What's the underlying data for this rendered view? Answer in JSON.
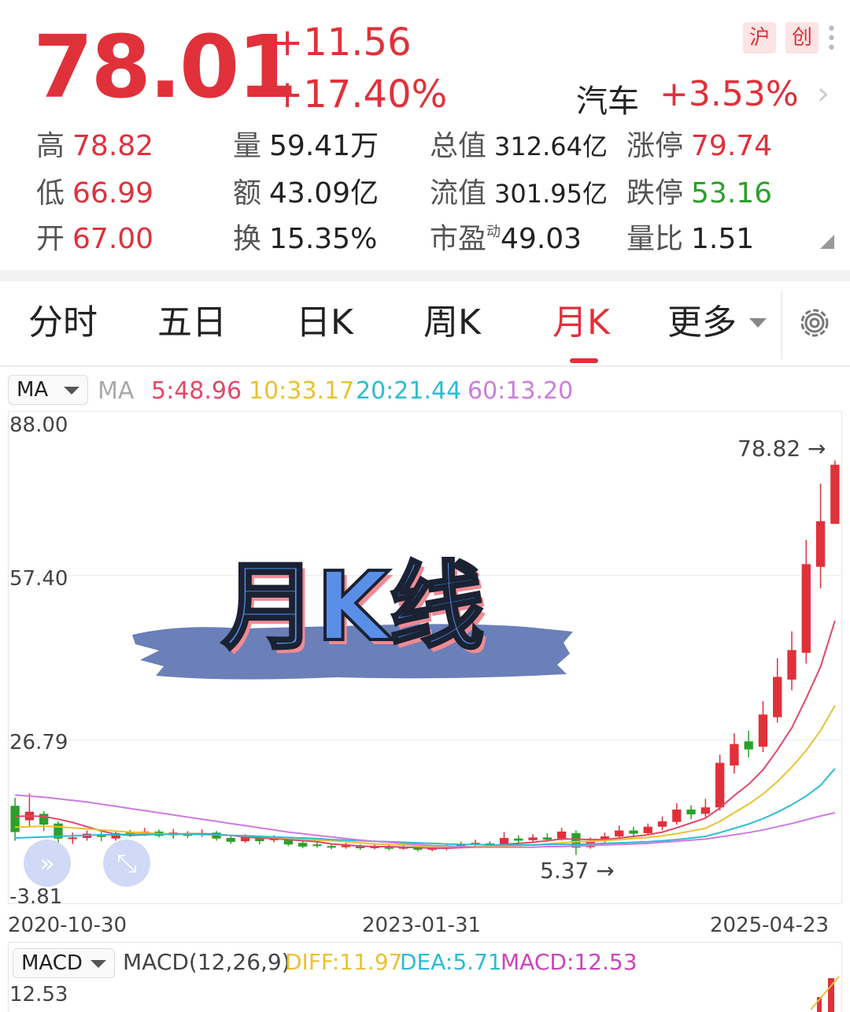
{
  "quote": {
    "price": "78.01",
    "change": "+11.56",
    "change_pct": "+17.40%",
    "badges": [
      "沪",
      "创"
    ],
    "sector": "汽车",
    "sector_pct": "+3.53%"
  },
  "stats": {
    "high_label": "高",
    "high": "78.82",
    "low_label": "低",
    "low": "66.99",
    "open_label": "开",
    "open": "67.00",
    "vol_label": "量",
    "vol": "59.41万",
    "amt_label": "额",
    "amt": "43.09亿",
    "turn_label": "换",
    "turn": "15.35%",
    "mcap_label": "总值",
    "mcap": "312.64亿",
    "fcap_label": "流值",
    "fcap": "301.95亿",
    "pe_label": "市盈",
    "pe_sup": "动",
    "pe": "49.03",
    "up_label": "涨停",
    "up": "79.74",
    "down_label": "跌停",
    "down": "53.16",
    "vr_label": "量比",
    "vr": "1.51"
  },
  "tabs": [
    "分时",
    "五日",
    "日K",
    "周K",
    "月K",
    "更多"
  ],
  "active_tab": "月K",
  "ma_row": {
    "dropdown": "MA",
    "label": "MA",
    "ma5": "5:48.96",
    "ma10": "10:33.17",
    "ma20": "20:21.44",
    "ma60": "60:13.20"
  },
  "colors": {
    "up": "#e0313b",
    "down": "#2ba02b",
    "ma5": "#e0486a",
    "ma10": "#e8c233",
    "ma20": "#2bbcd4",
    "ma60": "#cc7ce0"
  },
  "overlay_title": "月K线",
  "chart_data": {
    "type": "candlestick",
    "y_ticks": [
      "88.00",
      "57.40",
      "26.79",
      "-3.81"
    ],
    "ylim": [
      -3.81,
      88.0
    ],
    "x_ticks": [
      "2020-10-30",
      "2023-01-31",
      "2025-04-23"
    ],
    "max_annotation": "78.82 →",
    "min_annotation": "5.37 →",
    "candles": [
      [
        14.5,
        9.6,
        16.0,
        8.0
      ],
      [
        11.8,
        13.4,
        16.8,
        10.6
      ],
      [
        13.0,
        11.0,
        13.5,
        9.8
      ],
      [
        11.2,
        8.4,
        11.6,
        7.6
      ],
      [
        8.3,
        8.6,
        9.5,
        7.4
      ],
      [
        8.5,
        9.3,
        9.9,
        8.0
      ],
      [
        9.2,
        8.7,
        9.6,
        7.9
      ],
      [
        8.4,
        9.4,
        9.9,
        8.0
      ],
      [
        9.6,
        9.1,
        10.0,
        8.7
      ],
      [
        9.4,
        9.7,
        10.4,
        8.9
      ],
      [
        9.7,
        8.9,
        10.1,
        8.6
      ],
      [
        9.0,
        9.5,
        10.2,
        8.4
      ],
      [
        9.4,
        8.9,
        9.8,
        8.5
      ],
      [
        9.1,
        9.4,
        10.1,
        8.7
      ],
      [
        9.5,
        8.4,
        9.8,
        8.0
      ],
      [
        8.5,
        7.8,
        8.8,
        7.4
      ],
      [
        7.9,
        8.8,
        9.2,
        7.6
      ],
      [
        8.6,
        7.9,
        9.0,
        7.3
      ],
      [
        8.1,
        8.4,
        9.0,
        7.7
      ],
      [
        8.3,
        7.3,
        8.6,
        7.0
      ],
      [
        7.6,
        6.9,
        8.0,
        6.6
      ],
      [
        7.3,
        7.0,
        7.7,
        6.7
      ],
      [
        7.0,
        6.7,
        7.3,
        6.4
      ],
      [
        6.8,
        7.2,
        7.6,
        6.5
      ],
      [
        7.0,
        6.6,
        7.3,
        6.3
      ],
      [
        6.7,
        6.9,
        7.3,
        6.4
      ],
      [
        6.9,
        6.5,
        7.2,
        6.2
      ],
      [
        6.6,
        6.8,
        7.2,
        6.3
      ],
      [
        6.7,
        6.3,
        7.0,
        6.0
      ],
      [
        6.4,
        6.6,
        7.0,
        6.0
      ],
      [
        6.5,
        6.9,
        7.4,
        6.2
      ],
      [
        6.9,
        7.2,
        7.8,
        6.6
      ],
      [
        7.3,
        7.6,
        8.2,
        7.0
      ],
      [
        7.5,
        7.2,
        7.9,
        6.8
      ],
      [
        7.1,
        8.5,
        9.6,
        6.9
      ],
      [
        8.4,
        8.0,
        9.0,
        7.6
      ],
      [
        8.1,
        8.6,
        9.2,
        7.8
      ],
      [
        8.6,
        8.2,
        9.4,
        7.8
      ],
      [
        8.4,
        9.7,
        10.4,
        8.0
      ],
      [
        9.4,
        6.7,
        9.9,
        5.37
      ],
      [
        6.8,
        8.0,
        8.6,
        6.5
      ],
      [
        8.0,
        8.8,
        9.5,
        7.6
      ],
      [
        8.8,
        9.9,
        10.8,
        8.4
      ],
      [
        9.9,
        9.3,
        10.6,
        8.6
      ],
      [
        9.4,
        10.6,
        11.2,
        9.0
      ],
      [
        10.6,
        11.6,
        12.5,
        10.0
      ],
      [
        11.5,
        13.8,
        15.0,
        11.0
      ],
      [
        13.8,
        12.9,
        14.6,
        12.0
      ],
      [
        13.0,
        14.2,
        15.8,
        12.4
      ],
      [
        14.2,
        22.5,
        24.0,
        13.6
      ],
      [
        22.0,
        26.0,
        28.0,
        20.5
      ],
      [
        26.5,
        25.0,
        28.5,
        23.5
      ],
      [
        25.5,
        31.5,
        34.0,
        24.5
      ],
      [
        31.0,
        38.5,
        42.0,
        30.0
      ],
      [
        38.0,
        43.5,
        47.0,
        36.0
      ],
      [
        43.0,
        59.5,
        64.0,
        41.0
      ],
      [
        59.0,
        67.5,
        74.5,
        55.0
      ],
      [
        67.0,
        78.01,
        78.82,
        66.99
      ]
    ],
    "ma_series": [
      {
        "name": "MA5",
        "color": "#e0486a",
        "values": [
          12.5,
          12.6,
          12.5,
          12.0,
          11.4,
          10.6,
          9.8,
          9.2,
          9.0,
          9.1,
          9.2,
          9.2,
          9.3,
          9.3,
          9.2,
          9.0,
          8.7,
          8.5,
          8.4,
          8.2,
          8.0,
          7.8,
          7.4,
          7.2,
          7.0,
          6.9,
          6.9,
          6.8,
          6.7,
          6.6,
          6.6,
          6.7,
          6.8,
          7.0,
          7.3,
          7.5,
          7.7,
          8.0,
          8.3,
          8.3,
          8.2,
          8.2,
          8.5,
          8.8,
          9.1,
          9.6,
          10.4,
          11.3,
          12.2,
          14.1,
          16.4,
          18.5,
          21.2,
          24.9,
          29.0,
          34.5,
          40.4,
          48.96
        ]
      },
      {
        "name": "MA10",
        "color": "#e8c233",
        "values": [
          10.5,
          10.6,
          10.7,
          10.6,
          10.4,
          10.2,
          10.0,
          9.8,
          9.6,
          9.5,
          9.3,
          9.2,
          9.2,
          9.1,
          9.1,
          9.0,
          8.9,
          8.8,
          8.6,
          8.5,
          8.3,
          8.1,
          8.0,
          7.8,
          7.6,
          7.4,
          7.3,
          7.2,
          7.0,
          6.9,
          6.9,
          6.9,
          6.9,
          6.9,
          7.0,
          7.1,
          7.2,
          7.4,
          7.6,
          7.8,
          7.9,
          8.0,
          8.2,
          8.4,
          8.6,
          8.9,
          9.3,
          9.8,
          10.3,
          11.6,
          13.2,
          14.8,
          16.7,
          19.0,
          21.7,
          24.8,
          28.5,
          33.17
        ]
      },
      {
        "name": "MA20",
        "color": "#2bbcd4",
        "values": [
          8.5,
          8.6,
          8.7,
          8.8,
          8.9,
          9.0,
          9.1,
          9.1,
          9.2,
          9.2,
          9.2,
          9.2,
          9.2,
          9.2,
          9.1,
          9.0,
          8.9,
          8.8,
          8.7,
          8.6,
          8.5,
          8.4,
          8.2,
          8.1,
          8.0,
          7.9,
          7.8,
          7.7,
          7.6,
          7.5,
          7.4,
          7.3,
          7.3,
          7.2,
          7.2,
          7.2,
          7.2,
          7.3,
          7.3,
          7.3,
          7.4,
          7.5,
          7.6,
          7.7,
          7.8,
          8.0,
          8.2,
          8.5,
          8.8,
          9.5,
          10.3,
          11.1,
          12.1,
          13.3,
          14.7,
          16.3,
          18.3,
          21.44
        ]
      },
      {
        "name": "MA60",
        "color": "#cc7ce0",
        "values": [
          16.5,
          16.3,
          16.1,
          15.8,
          15.5,
          15.2,
          14.8,
          14.4,
          14.0,
          13.6,
          13.2,
          12.8,
          12.4,
          12.0,
          11.6,
          11.2,
          10.8,
          10.4,
          10.0,
          9.6,
          9.3,
          9.0,
          8.7,
          8.4,
          8.1,
          7.9,
          7.7,
          7.5,
          7.3,
          7.1,
          7.0,
          6.9,
          6.8,
          6.8,
          6.8,
          6.8,
          6.8,
          6.9,
          6.9,
          7.0,
          7.1,
          7.2,
          7.3,
          7.4,
          7.5,
          7.7,
          7.9,
          8.1,
          8.3,
          8.7,
          9.1,
          9.5,
          10.0,
          10.6,
          11.2,
          11.9,
          12.6,
          13.2
        ]
      }
    ]
  },
  "macd_row": {
    "dropdown": "MACD",
    "params": "MACD(12,26,9)",
    "diff": "DIFF:11.97",
    "dea": "DEA:5.71",
    "macd": "MACD:12.53",
    "y_top": "12.53"
  }
}
